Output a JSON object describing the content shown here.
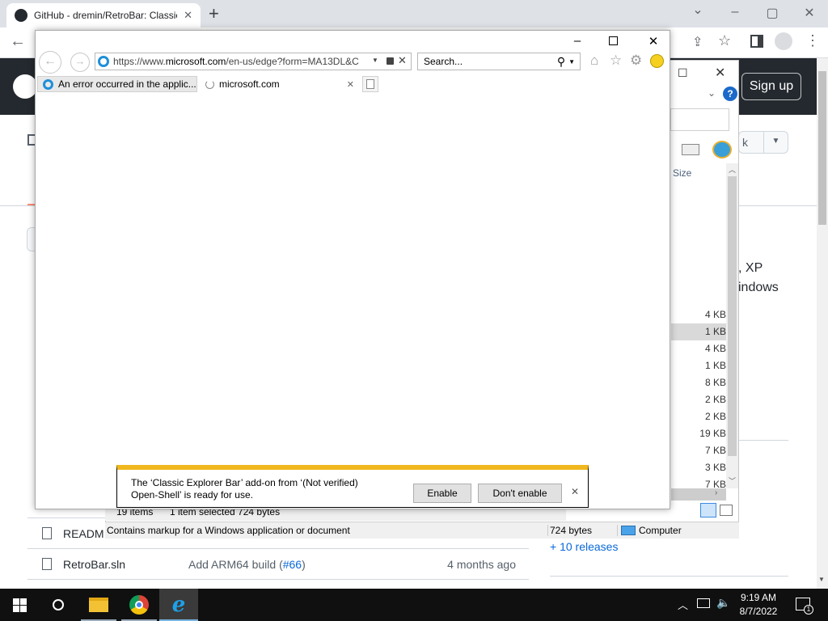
{
  "chrome": {
    "tab_title": "GitHub - dremin/RetroBar: Classic",
    "new_tab": "+",
    "win_min": "–",
    "win_max": "▢",
    "win_close": "✕",
    "chevron": "⌄"
  },
  "github": {
    "signup": "Sign up",
    "about_frag1": ", XP",
    "about_frag2": "indows",
    "releases": "+ 10 releases",
    "files": [
      {
        "name": "READM",
        "msg": "",
        "time": ""
      },
      {
        "name": "RetroBar.sln",
        "msg": "Add ARM64 build (",
        "link": "#66",
        "msg_end": ")",
        "time": "4 months ago"
      }
    ]
  },
  "explorer": {
    "size_header": "Size",
    "sizes": [
      "4 KB",
      "1 KB",
      "4 KB",
      "1 KB",
      "8 KB",
      "2 KB",
      "2 KB",
      "19 KB",
      "7 KB",
      "3 KB",
      "7 KB"
    ],
    "items_count": "19 items",
    "selected": "1 item selected  724 bytes",
    "status_desc": "Contains markup for a Windows application or document",
    "status_size": "724 bytes",
    "status_location": "Computer",
    "partial_k": "k"
  },
  "ie": {
    "url_prefix": "https://www.",
    "url_domain": "microsoft.com",
    "url_rest": "/en-us/edge?form=MA13DL&C",
    "search_placeholder": "Search...",
    "tabs": [
      {
        "label": "An error occurred in the applic..."
      },
      {
        "label": "microsoft.com"
      }
    ],
    "win_min": "–",
    "win_max": "☐",
    "win_close": "✕"
  },
  "infobar": {
    "line1": "The ‘Classic Explorer Bar’ add-on from ‘(Not verified)",
    "line2": "Open-Shell’ is ready for use.",
    "enable": "Enable",
    "dont_enable": "Don't enable",
    "close": "✕"
  },
  "taskbar": {
    "time": "9:19 AM",
    "date": "8/7/2022",
    "notif_count": "1"
  },
  "colors": {
    "infobar_accent": "#f0b81e",
    "github_header": "#24292f",
    "taskbar": "#101010",
    "link": "#0969da"
  }
}
